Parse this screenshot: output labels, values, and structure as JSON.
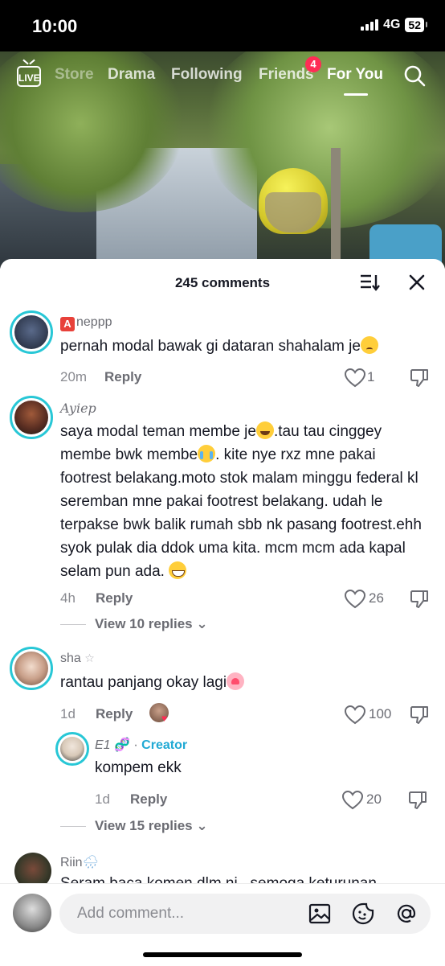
{
  "status_bar": {
    "time": "10:00",
    "network": "4G",
    "battery": "52"
  },
  "top_nav": {
    "live_label": "LIVE",
    "tabs": [
      {
        "label": "Store"
      },
      {
        "label": "Drama"
      },
      {
        "label": "Following"
      },
      {
        "label": "Friends"
      },
      {
        "label": "For You"
      }
    ],
    "friends_badge": "4",
    "active_tab": "For You"
  },
  "comments_sheet": {
    "title": "245 comments",
    "reply_label": "Reply",
    "comments": [
      {
        "username": "neppp",
        "username_prefix": "A",
        "text": "pernah modal bawak gi dataran shahalam je",
        "time": "20m",
        "likes": "1",
        "avatar_color": "#38435a"
      },
      {
        "username": "Ayiep",
        "text_parts": [
          "saya modal teman membe je",
          ".tau tau cinggey membe bwk membe",
          ". kite nye rxz mne pakai footrest belakang.moto stok malam minggu federal kl seremban mne pakai footrest belakang. udah le terpakse bwk balik rumah sbb nk pasang footrest.ehh syok pulak dia ddok uma kita. mcm mcm ada kapal selam pun ada. "
        ],
        "time": "4h",
        "likes": "26",
        "view_replies": "View 10 replies",
        "avatar_color": "#5a2e22"
      },
      {
        "username": "sha",
        "text": "rantau panjang okay lagi",
        "time": "1d",
        "likes": "100",
        "avatar_color": "#c9a08a",
        "reply": {
          "username": "E1",
          "creator_label": "Creator",
          "text": "kompem ekk",
          "time": "1d",
          "likes": "20",
          "avatar_color": "#d8c9b8"
        },
        "view_replies": "View 15 replies"
      },
      {
        "username": "Riin",
        "text": "Seram baca komen dlm ni , semoga keturunan",
        "avatar_color": "#3a3a2a"
      }
    ]
  },
  "input_bar": {
    "placeholder": "Add comment..."
  }
}
